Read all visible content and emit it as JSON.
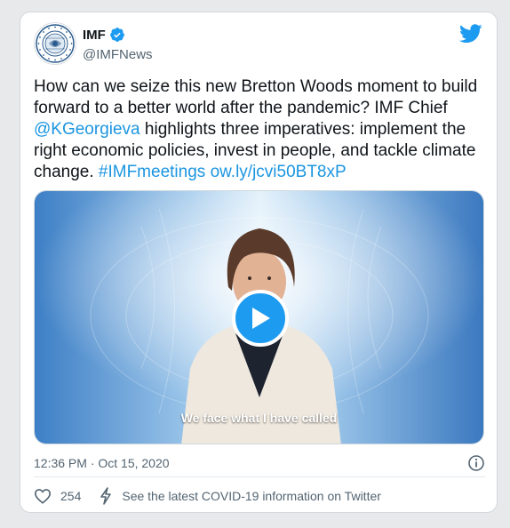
{
  "tweet": {
    "display_name": "IMF",
    "handle": "@IMFNews",
    "text_part1": "How can we seize this new Bretton Woods moment to build forward to a better world after the pandemic? IMF Chief ",
    "mention": "@KGeorgieva",
    "text_part2": " highlights three imperatives: implement the right economic policies, invest in people, and tackle climate change. ",
    "hashtag": "#IMFmeetings",
    "url": "ow.ly/jcvi50BT8xP",
    "video_caption": "We face what I have called",
    "timestamp": "12:36 PM · Oct 15, 2020",
    "like_count": "254",
    "covid_info": "See the latest COVID-19 information on Twitter"
  },
  "icons": {
    "verified": "verified-badge-icon",
    "twitter": "twitter-bird-icon",
    "play": "play-icon",
    "info": "info-icon",
    "like": "heart-icon",
    "covid": "lightning-icon"
  },
  "colors": {
    "link": "#1b95e0",
    "accent": "#1d9bf0",
    "text": "#0f1419",
    "muted": "#536471",
    "background": "#e8e9eb"
  }
}
